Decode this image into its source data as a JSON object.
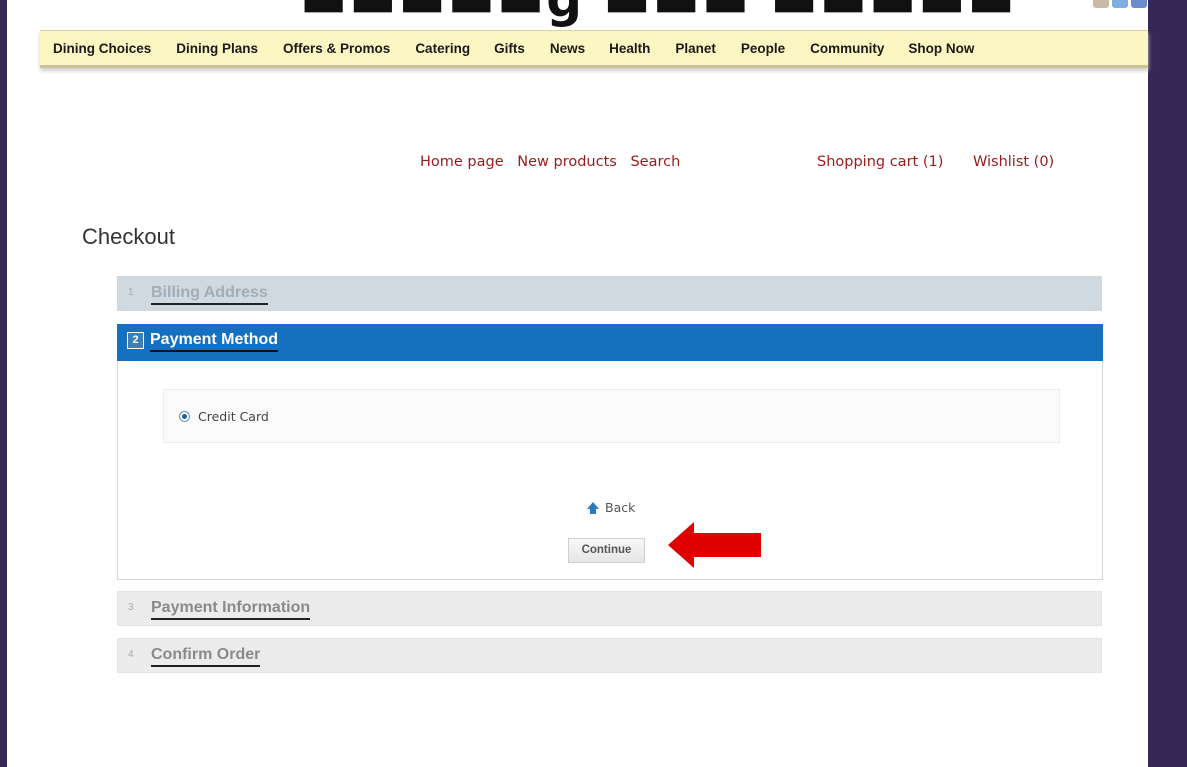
{
  "top_nav": {
    "items": [
      "Dining Choices",
      "Dining Plans",
      "Offers & Promos",
      "Catering",
      "Gifts",
      "News",
      "Health",
      "Planet",
      "People",
      "Community",
      "Shop Now"
    ]
  },
  "header_links": {
    "home": "Home page",
    "new_products": "New products",
    "search": "Search",
    "cart": "Shopping cart (1)",
    "wishlist": "Wishlist (0)"
  },
  "page_title": "Checkout",
  "steps": [
    {
      "number": "1",
      "label": "Billing Address"
    },
    {
      "number": "2",
      "label": "Payment Method"
    },
    {
      "number": "3",
      "label": "Payment Information"
    },
    {
      "number": "4",
      "label": "Confirm Order"
    }
  ],
  "payment_method": {
    "option_label": "Credit Card",
    "selected": true
  },
  "actions": {
    "back_label": "Back",
    "continue_label": "Continue"
  },
  "colors": {
    "active_step": "#1570c0",
    "nav_bg": "#fbf6c2",
    "link_red": "#9b1b1b",
    "annotation_arrow": "#e00000"
  }
}
